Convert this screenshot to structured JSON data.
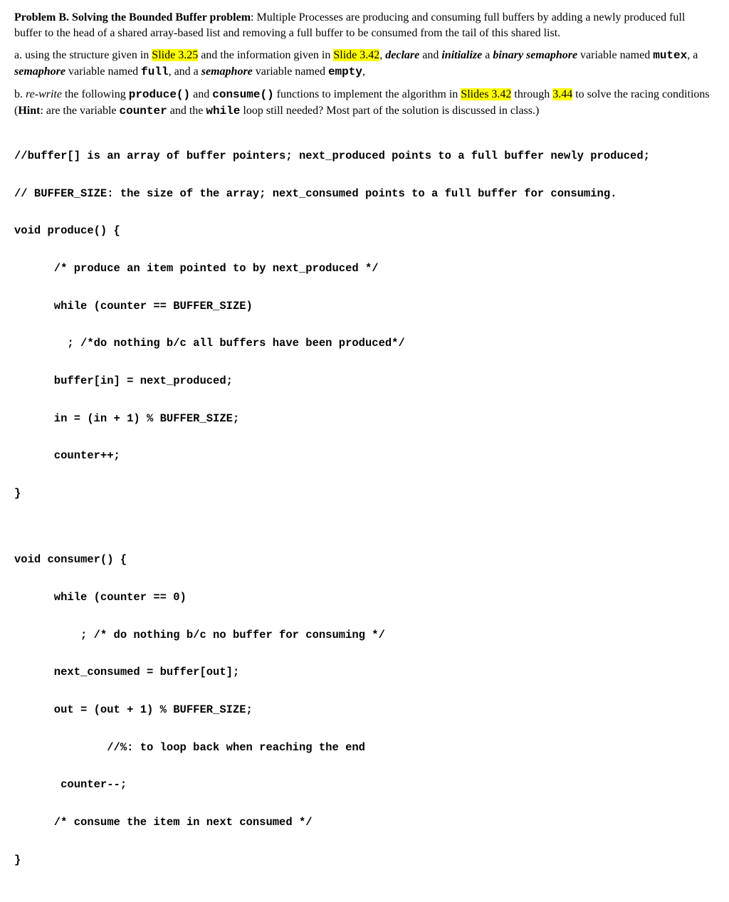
{
  "intro": {
    "label": "Problem B. Solving the Bounded Buffer problem",
    "sentence": ": Multiple Processes are producing and consuming full buffers by adding a newly produced full buffer to the head of a shared array-based list and removing a full buffer to be consumed from the tail of this shared list."
  },
  "partA": {
    "t1": "a. using the structure given in ",
    "slide1": "Slide 3.25",
    "t2": " and the information given in ",
    "slide2": "Slide 3.42",
    "t3": ", ",
    "declare": "declare",
    "t4": " and ",
    "initialize": "initialize",
    "t5": " a ",
    "binsem": "binary semaphore",
    "t6": " variable named ",
    "mutex": "mutex",
    "t7": ", a ",
    "sem1": "semaphore",
    "t8": " variable named ",
    "full": "full",
    "t9": ", and a ",
    "sem2": "semaphore",
    "t10": " variable named ",
    "empty": "empty",
    "t11": ","
  },
  "partB": {
    "t1": "b. ",
    "rewrite": "re-write",
    "t2": " the following ",
    "produce": "produce()",
    "t3": " and ",
    "consume": "consume()",
    "t4": " functions to implement the algorithm in ",
    "slides": "Slides 3.42",
    "t5": " through ",
    "slide344": "3.44",
    "t6": " to solve the racing conditions (",
    "hint": "Hint",
    "t7": ": are the variable ",
    "counter": "counter",
    "t8": " and the ",
    "while": "while",
    "t9": " loop still needed? Most part of the solution is discussed in class.)"
  },
  "code": {
    "c1": "//buffer[] is an array of buffer pointers; next_produced points to a full buffer newly produced;",
    "c2": "// BUFFER_SIZE: the size of the array; next_consumed points to a full buffer for consuming.",
    "c3": "void produce() {",
    "c4": "      /* produce an item pointed to by next_produced */",
    "c5": "      while (counter == BUFFER_SIZE)",
    "c6": "        ; /*do nothing b/c all buffers have been produced*/",
    "c7": "      buffer[in] = next_produced;",
    "c8": "      in = (in + 1) % BUFFER_SIZE;",
    "c9": "      counter++;",
    "c10": "}",
    "c11": "void consumer() {",
    "c12": "      while (counter == 0)",
    "c13": "          ; /* do nothing b/c no buffer for consuming */",
    "c14": "      next_consumed = buffer[out];",
    "c15": "      out = (out + 1) % BUFFER_SIZE;",
    "c16": "              //%: to loop back when reaching the end",
    "c17": "       counter--;",
    "c18": "      /* consume the item in next consumed */",
    "c19": "}"
  }
}
